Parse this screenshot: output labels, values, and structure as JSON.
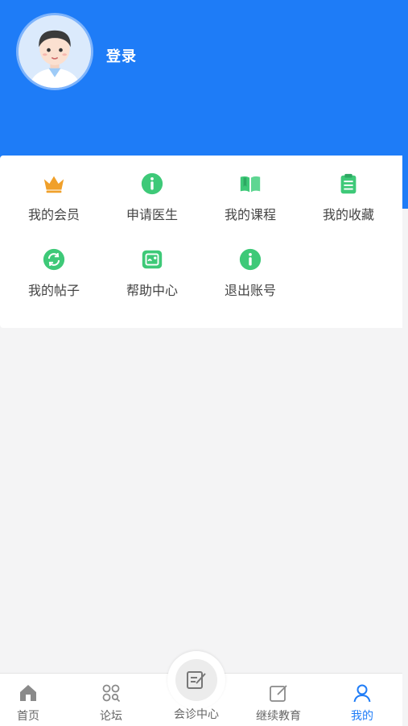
{
  "header": {
    "login_label": "登录"
  },
  "menu": {
    "items": [
      {
        "label": "我的会员",
        "icon": "crown-icon"
      },
      {
        "label": "申请医生",
        "icon": "info-icon"
      },
      {
        "label": "我的课程",
        "icon": "book-icon"
      },
      {
        "label": "我的收藏",
        "icon": "clipboard-icon"
      },
      {
        "label": "我的帖子",
        "icon": "refresh-icon"
      },
      {
        "label": "帮助中心",
        "icon": "support-icon"
      },
      {
        "label": "退出账号",
        "icon": "info-icon"
      }
    ]
  },
  "tabbar": {
    "tabs": [
      {
        "label": "首页",
        "icon": "home-icon"
      },
      {
        "label": "论坛",
        "icon": "forum-icon"
      },
      {
        "label": "会诊中心",
        "icon": "consult-icon"
      },
      {
        "label": "继续教育",
        "icon": "edit-icon"
      },
      {
        "label": "我的",
        "icon": "user-icon"
      }
    ],
    "active": "我的"
  },
  "colors": {
    "primary": "#1e7cf7",
    "green": "#3ec978",
    "gold": "#f0a02a"
  }
}
